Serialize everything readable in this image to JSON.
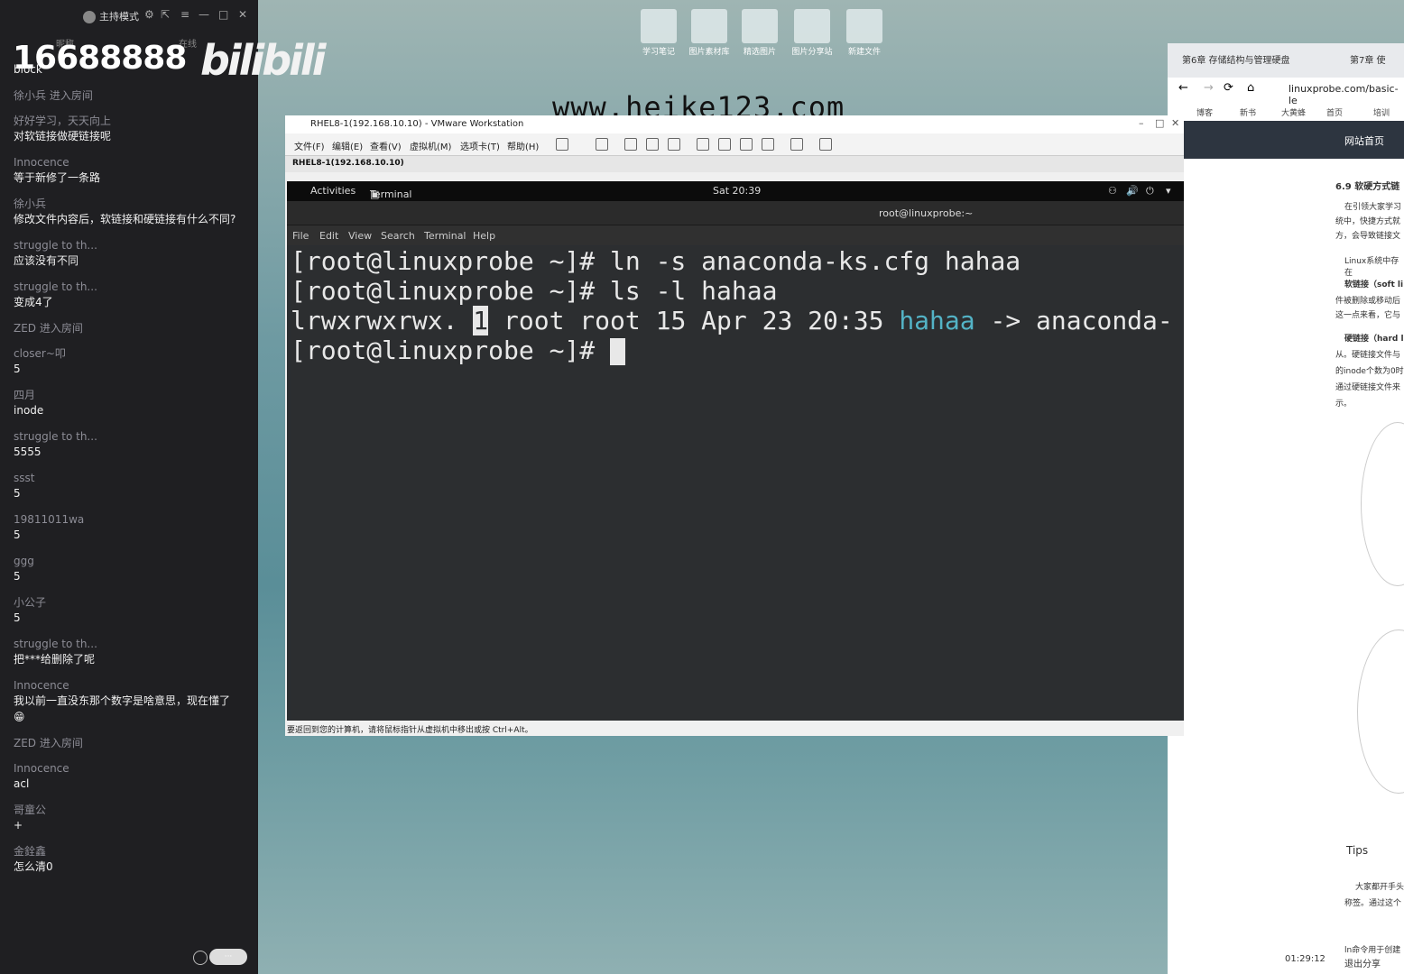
{
  "chat": {
    "mode_label": "主持模式",
    "room_number": "16688888",
    "logo_text": "bilibili",
    "tag_left": "昵称",
    "tag_right": "在线",
    "first_line": "block",
    "messages": [
      {
        "user": "徐小兵 进入房间",
        "text": ""
      },
      {
        "user": "好好学习，天天向上",
        "text": "对软链接做硬链接呢"
      },
      {
        "user": "Innocence",
        "text": "等于新修了一条路"
      },
      {
        "user": "徐小兵",
        "text": "修改文件内容后，软链接和硬链接有什么不同?"
      },
      {
        "user": "struggle to th...",
        "text": "应该没有不同"
      },
      {
        "user": "struggle to th...",
        "text": "变成4了"
      },
      {
        "user": "ZED 进入房间",
        "text": ""
      },
      {
        "user": "closer~叩",
        "text": "5"
      },
      {
        "user": "四月",
        "text": "inode"
      },
      {
        "user": "struggle to th...",
        "text": "5555"
      },
      {
        "user": "ssst",
        "text": "5"
      },
      {
        "user": "19811011wa",
        "text": "5"
      },
      {
        "user": "ggg",
        "text": "5"
      },
      {
        "user": "小公子",
        "text": "5"
      },
      {
        "user": "struggle to th...",
        "text": "把***给删除了呢"
      },
      {
        "user": "Innocence",
        "text": "我以前一直没东那个数字是啥意思，现在懂了😁"
      },
      {
        "user": "ZED 进入房间",
        "text": ""
      },
      {
        "user": "Innocence",
        "text": "acl"
      },
      {
        "user": "哥童公",
        "text": "+"
      },
      {
        "user": "金銓鑫",
        "text": "怎么清0"
      }
    ]
  },
  "desktop": {
    "icons": [
      "学习笔记",
      "图片素材库",
      "精选图片",
      "图片分享站",
      "新建文件"
    ],
    "watermark": "www.heike123.com"
  },
  "vmware": {
    "title": "RHEL8-1(192.168.10.10) - VMware Workstation",
    "menu": [
      "文件(F)",
      "编辑(E)",
      "查看(V)",
      "虚拟机(M)",
      "选项卡(T)",
      "帮助(H)"
    ],
    "tab": "RHEL8-1(192.168.10.10)",
    "status": "要返回到您的计算机，请将鼠标指针从虚拟机中移出或按 Ctrl+Alt。"
  },
  "gnome": {
    "activities": "Activities",
    "app": "Terminal ▾",
    "clock": "Sat 20:39"
  },
  "terminal": {
    "title": "root@linuxprobe:~",
    "menu": [
      "File",
      "Edit",
      "View",
      "Search",
      "Terminal",
      "Help"
    ],
    "line1": "[root@linuxprobe ~]# ln -s anaconda-ks.cfg hahaa",
    "line2": "[root@linuxprobe ~]# ls -l hahaa",
    "line3_perm": "lrwxrwxrwx. ",
    "line3_links": "1",
    "line3_mid": " root root 15 Apr 23 20:35 ",
    "line3_name": "hahaa",
    "line3_tail": " -> anaconda-",
    "prompt": "[root@linuxprobe ~]# "
  },
  "browser": {
    "tab1": "第6章 存储结构与管理硬盘",
    "tab2": "第7章 使",
    "url": "linuxprobe.com/basic-le",
    "bookmarks": [
      "博客",
      "新书",
      "大黄蜂",
      "首页",
      "培训"
    ],
    "site_nav": "网站首页",
    "section_heading": "6.9 软硬方式链",
    "texts": [
      "在引领大家学习",
      "统中，快捷方式就",
      "方，会导致链接文",
      "Linux系统中存在",
      "软链接（soft li",
      "件被删除或移动后",
      "这一点来看，它与",
      "硬链接（hard l",
      "从。硬链接文件与",
      "的inode个数为0时",
      "通过硬链接文件来",
      "示。"
    ],
    "tips": "Tips",
    "tips_text1": "大家都开手头",
    "tips_text2": "称签。通过这个",
    "clock": "01:29:12",
    "share": "退出分享",
    "footer_text": "ln命令用于创建"
  }
}
